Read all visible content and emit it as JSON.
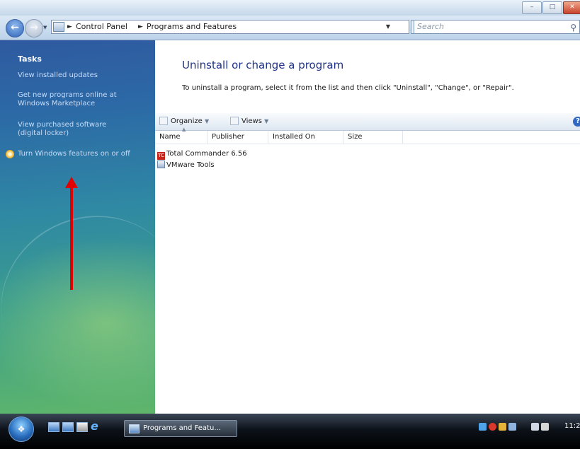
{
  "navbar": {
    "breadcrumb": [
      "Control Panel",
      "Programs and Features"
    ],
    "search_placeholder": "Search"
  },
  "tasks": {
    "heading": "Tasks",
    "links": [
      "View installed updates",
      "Get new programs online at Windows Marketplace",
      "View purchased software (digital locker)",
      "Turn Windows features on or off"
    ]
  },
  "main": {
    "title": "Uninstall or change a program",
    "subtitle": "To uninstall a program, select it from the list and then click \"Uninstall\", \"Change\", or \"Repair\"."
  },
  "toolbar": {
    "organize_label": "Organize",
    "views_label": "Views"
  },
  "columns": [
    "Name",
    "Publisher",
    "Installed On",
    "Size"
  ],
  "programs": [
    {
      "name": "Total Commander 6.56",
      "icon": "total-commander-icon"
    },
    {
      "name": "VMware Tools",
      "icon": "vmware-tools-icon"
    }
  ],
  "taskbar": {
    "task_button_label": "Programs and Featu...",
    "clock": "11:2"
  },
  "colors": {
    "task_pane_top": "#2f5aa0",
    "task_pane_bottom": "#5fb66a",
    "title_blue": "#1e3287",
    "annotation_arrow": "#e00000"
  }
}
